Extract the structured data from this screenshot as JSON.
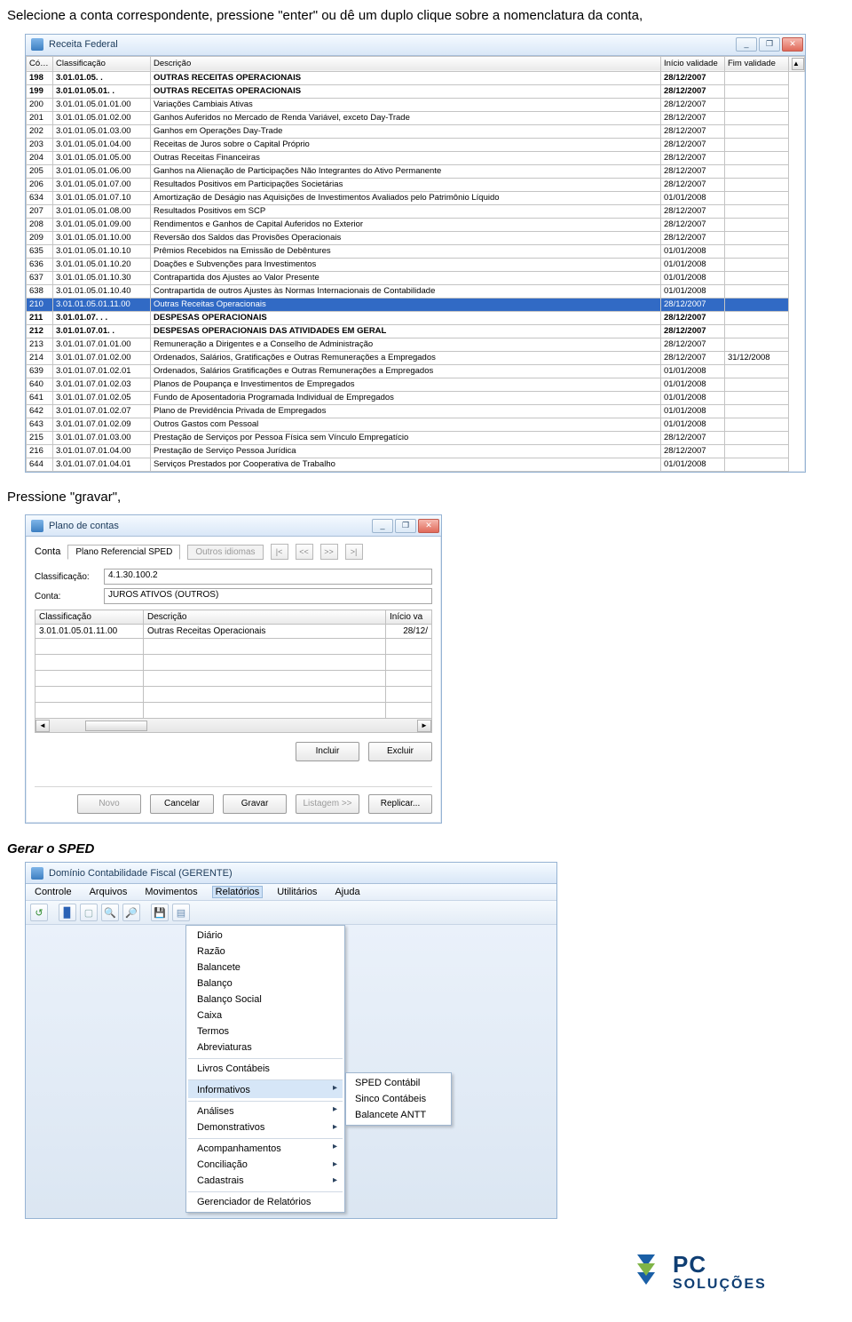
{
  "intro_text": "Selecione a conta correspondente, pressione \"enter\" ou dê um duplo clique sobre a nomenclatura da conta,",
  "win1": {
    "title": "Receita Federal",
    "headers": {
      "codigo": "Código",
      "clas": "Classificação",
      "desc": "Descrição",
      "iv": "Início validade",
      "fv": "Fim validade"
    },
    "rows": [
      {
        "cod": "198",
        "clas": "3.01.01.05. .",
        "desc": "OUTRAS RECEITAS OPERACIONAIS",
        "iv": "28/12/2007",
        "fv": "",
        "bold": true
      },
      {
        "cod": "199",
        "clas": "3.01.01.05.01. .",
        "desc": "OUTRAS RECEITAS OPERACIONAIS",
        "iv": "28/12/2007",
        "fv": "",
        "bold": true
      },
      {
        "cod": "200",
        "clas": "3.01.01.05.01.01.00",
        "desc": "Variações Cambiais Ativas",
        "iv": "28/12/2007",
        "fv": ""
      },
      {
        "cod": "201",
        "clas": "3.01.01.05.01.02.00",
        "desc": "Ganhos Auferidos no Mercado de Renda Variável, exceto Day-Trade",
        "iv": "28/12/2007",
        "fv": ""
      },
      {
        "cod": "202",
        "clas": "3.01.01.05.01.03.00",
        "desc": "Ganhos em Operações Day-Trade",
        "iv": "28/12/2007",
        "fv": ""
      },
      {
        "cod": "203",
        "clas": "3.01.01.05.01.04.00",
        "desc": "Receitas de Juros sobre o Capital Próprio",
        "iv": "28/12/2007",
        "fv": ""
      },
      {
        "cod": "204",
        "clas": "3.01.01.05.01.05.00",
        "desc": "Outras Receitas Financeiras",
        "iv": "28/12/2007",
        "fv": ""
      },
      {
        "cod": "205",
        "clas": "3.01.01.05.01.06.00",
        "desc": "Ganhos na Alienação de Participações Não Integrantes do Ativo Permanente",
        "iv": "28/12/2007",
        "fv": ""
      },
      {
        "cod": "206",
        "clas": "3.01.01.05.01.07.00",
        "desc": "Resultados Positivos em Participações Societárias",
        "iv": "28/12/2007",
        "fv": ""
      },
      {
        "cod": "634",
        "clas": "3.01.01.05.01.07.10",
        "desc": "Amortização de Deságio nas Aquisições de Investimentos Avaliados pelo Patrimônio Líquido",
        "iv": "01/01/2008",
        "fv": ""
      },
      {
        "cod": "207",
        "clas": "3.01.01.05.01.08.00",
        "desc": "Resultados Positivos em SCP",
        "iv": "28/12/2007",
        "fv": ""
      },
      {
        "cod": "208",
        "clas": "3.01.01.05.01.09.00",
        "desc": "Rendimentos e Ganhos de Capital Auferidos no Exterior",
        "iv": "28/12/2007",
        "fv": ""
      },
      {
        "cod": "209",
        "clas": "3.01.01.05.01.10.00",
        "desc": "Reversão dos Saldos das Provisões Operacionais",
        "iv": "28/12/2007",
        "fv": ""
      },
      {
        "cod": "635",
        "clas": "3.01.01.05.01.10.10",
        "desc": "Prêmios Recebidos na Emissão de Debêntures",
        "iv": "01/01/2008",
        "fv": ""
      },
      {
        "cod": "636",
        "clas": "3.01.01.05.01.10.20",
        "desc": "Doações e Subvenções para Investimentos",
        "iv": "01/01/2008",
        "fv": ""
      },
      {
        "cod": "637",
        "clas": "3.01.01.05.01.10.30",
        "desc": "Contrapartida dos Ajustes ao Valor Presente",
        "iv": "01/01/2008",
        "fv": ""
      },
      {
        "cod": "638",
        "clas": "3.01.01.05.01.10.40",
        "desc": "Contrapartida de outros Ajustes às Normas Internacionais de Contabilidade",
        "iv": "01/01/2008",
        "fv": ""
      },
      {
        "cod": "210",
        "clas": "3.01.01.05.01.11.00",
        "desc": "Outras Receitas Operacionais",
        "iv": "28/12/2007",
        "fv": "",
        "sel": true
      },
      {
        "cod": "211",
        "clas": "3.01.01.07. . .",
        "desc": "DESPESAS OPERACIONAIS",
        "iv": "28/12/2007",
        "fv": "",
        "bold": true
      },
      {
        "cod": "212",
        "clas": "3.01.01.07.01. .",
        "desc": "DESPESAS OPERACIONAIS DAS ATIVIDADES EM GERAL",
        "iv": "28/12/2007",
        "fv": "",
        "bold": true
      },
      {
        "cod": "213",
        "clas": "3.01.01.07.01.01.00",
        "desc": "Remuneração a Dirigentes e a Conselho de Administração",
        "iv": "28/12/2007",
        "fv": ""
      },
      {
        "cod": "214",
        "clas": "3.01.01.07.01.02.00",
        "desc": "Ordenados, Salários, Gratificações e Outras Remunerações a Empregados",
        "iv": "28/12/2007",
        "fv": "31/12/2008"
      },
      {
        "cod": "639",
        "clas": "3.01.01.07.01.02.01",
        "desc": "Ordenados, Salários Gratificações e Outras Remunerações a Empregados",
        "iv": "01/01/2008",
        "fv": ""
      },
      {
        "cod": "640",
        "clas": "3.01.01.07.01.02.03",
        "desc": "Planos de Poupança e Investimentos de Empregados",
        "iv": "01/01/2008",
        "fv": ""
      },
      {
        "cod": "641",
        "clas": "3.01.01.07.01.02.05",
        "desc": "Fundo de Aposentadoria Programada Individual de Empregados",
        "iv": "01/01/2008",
        "fv": ""
      },
      {
        "cod": "642",
        "clas": "3.01.01.07.01.02.07",
        "desc": "Plano de Previdência Privada de Empregados",
        "iv": "01/01/2008",
        "fv": ""
      },
      {
        "cod": "643",
        "clas": "3.01.01.07.01.02.09",
        "desc": "Outros Gastos com Pessoal",
        "iv": "01/01/2008",
        "fv": ""
      },
      {
        "cod": "215",
        "clas": "3.01.01.07.01.03.00",
        "desc": "Prestação de Serviços por Pessoa Física sem Vínculo Empregatício",
        "iv": "28/12/2007",
        "fv": ""
      },
      {
        "cod": "216",
        "clas": "3.01.01.07.01.04.00",
        "desc": "Prestação de Serviço Pessoa Jurídica",
        "iv": "28/12/2007",
        "fv": ""
      },
      {
        "cod": "644",
        "clas": "3.01.01.07.01.04.01",
        "desc": "Serviços Prestados por Cooperativa de Trabalho",
        "iv": "01/01/2008",
        "fv": ""
      }
    ]
  },
  "mid_text": "Pressione \"gravar\",",
  "win2": {
    "title": "Plano de contas",
    "conta_label": "Conta",
    "tabs": {
      "main": "Plano Referencial SPED",
      "other": "Outros idiomas"
    },
    "nav": {
      "first": "|<",
      "prev": "<<",
      "next": ">>",
      "last": ">|"
    },
    "fields": {
      "clas_label": "Classificação:",
      "clas_value": "4.1.30.100.2",
      "conta_label2": "Conta:",
      "conta_value": "JUROS ATIVOS (OUTROS)"
    },
    "grid_headers": {
      "c1": "Classificação",
      "c2": "Descrição",
      "c3": "Início va"
    },
    "grid_row": {
      "c1": "3.01.01.05.01.11.00",
      "c2": "Outras Receitas Operacionais",
      "c3": "28/12/"
    },
    "buttons": {
      "incluir": "Incluir",
      "excluir": "Excluir",
      "novo": "Novo",
      "cancelar": "Cancelar",
      "gravar": "Gravar",
      "listagem": "Listagem >>",
      "replicar": "Replicar..."
    }
  },
  "section_heading": "Gerar o SPED",
  "win3": {
    "title": "Domínio Contabilidade Fiscal  (GERENTE)",
    "menubar": [
      "Controle",
      "Arquivos",
      "Movimentos",
      "Relatórios",
      "Utilitários",
      "Ajuda"
    ],
    "dropdown": [
      {
        "t": "Diário"
      },
      {
        "t": "Razão"
      },
      {
        "t": "Balancete"
      },
      {
        "t": "Balanço"
      },
      {
        "t": "Balanço Social"
      },
      {
        "t": "Caixa"
      },
      {
        "t": "Termos"
      },
      {
        "t": "Abreviaturas"
      },
      {
        "t": "Livros Contábeis",
        "sep": true
      },
      {
        "t": "Informativos",
        "sep": true,
        "sub": true,
        "hi": true
      },
      {
        "t": "Análises",
        "sep": true,
        "sub": true
      },
      {
        "t": "Demonstrativos",
        "sub": true
      },
      {
        "t": "Acompanhamentos",
        "sep": true,
        "sub": true
      },
      {
        "t": "Conciliação",
        "sub": true
      },
      {
        "t": "Cadastrais",
        "sub": true
      },
      {
        "t": "Gerenciador de Relatórios",
        "sep": true
      }
    ],
    "submenu": [
      "SPED Contábil",
      "Sinco Contábeis",
      "Balancete ANTT"
    ]
  },
  "logo": {
    "brand_top": "PC",
    "brand_bottom": "SOLUÇÕES"
  }
}
